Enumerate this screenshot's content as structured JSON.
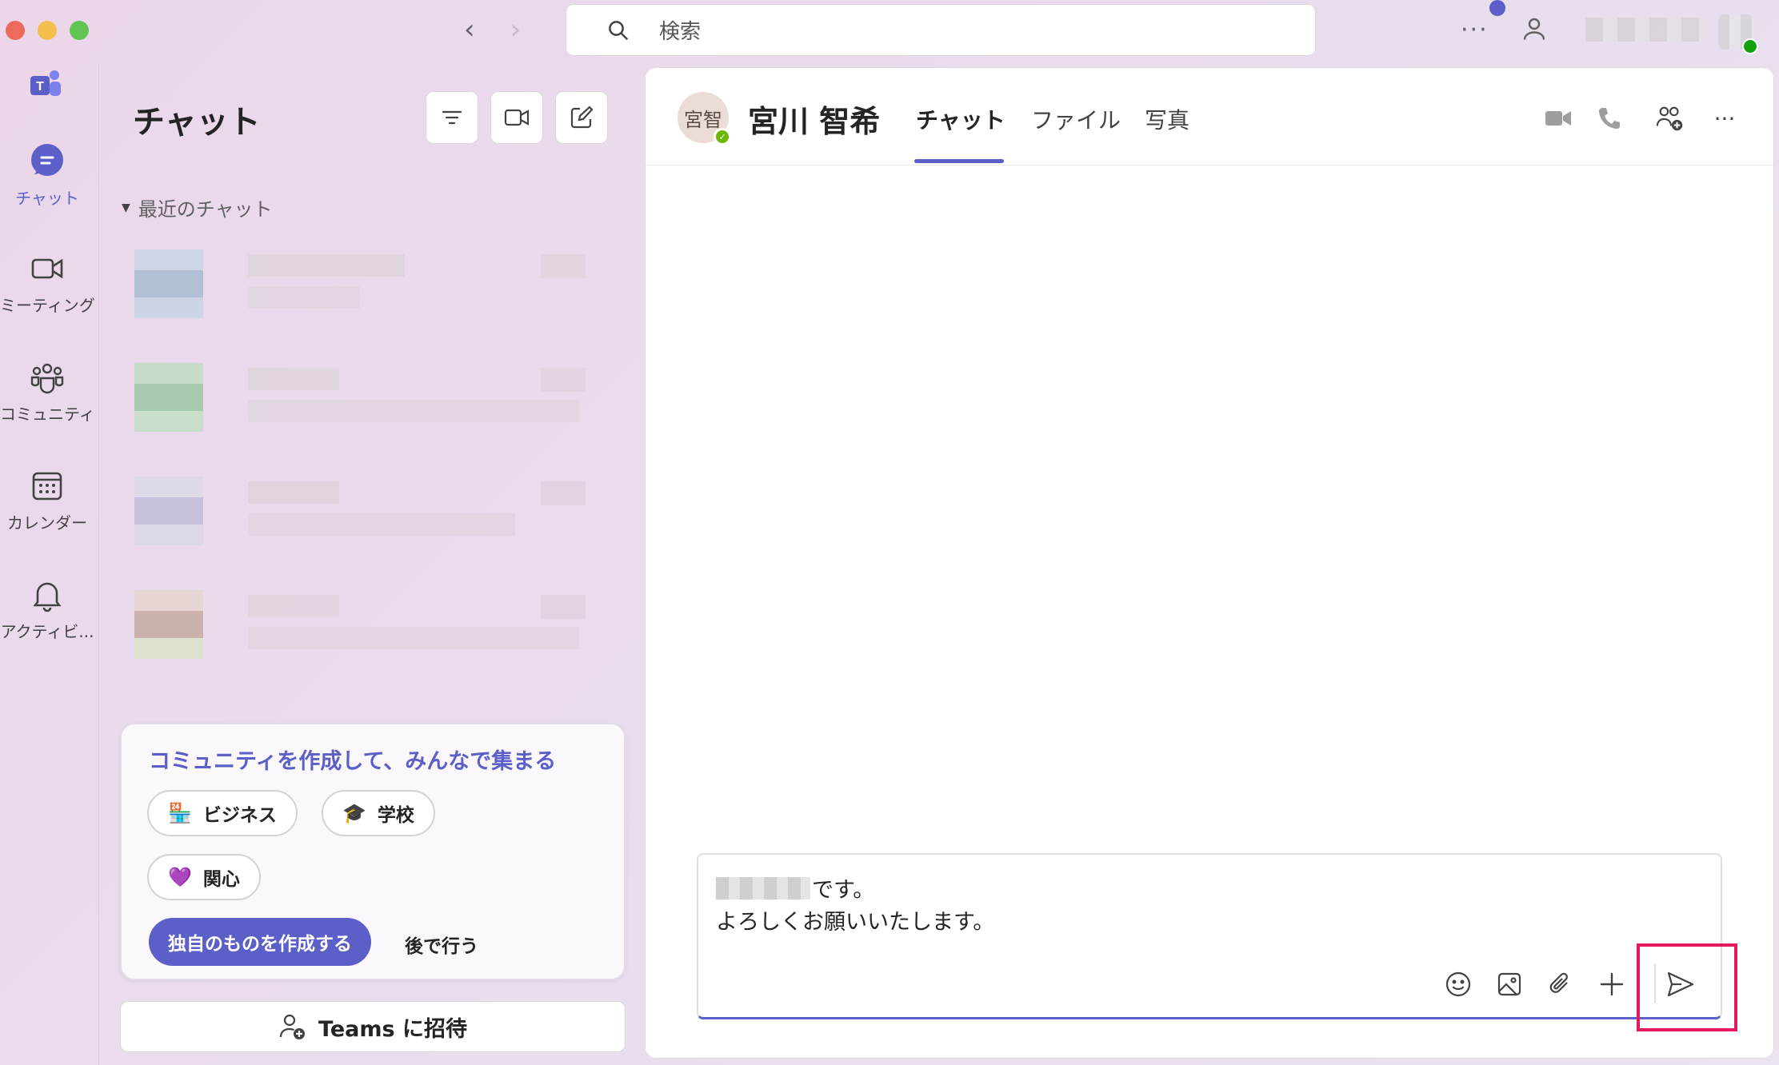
{
  "window": {
    "search_placeholder": "検索"
  },
  "rail": {
    "items": [
      {
        "label": "チャット",
        "active": true
      },
      {
        "label": "ミーティング"
      },
      {
        "label": "コミュニティ"
      },
      {
        "label": "カレンダー"
      },
      {
        "label": "アクティビ..."
      }
    ]
  },
  "chat_panel": {
    "title": "チャット",
    "section_label": "最近のチャット"
  },
  "community_card": {
    "title": "コミュニティを作成して、みんなで集まる",
    "chips": [
      {
        "emoji": "🏪",
        "label": "ビジネス"
      },
      {
        "emoji": "🎓",
        "label": "学校"
      },
      {
        "emoji": "💜",
        "label": "関心"
      }
    ],
    "primary_label": "独自のものを作成する",
    "later_label": "後で行う"
  },
  "invite": {
    "label": "Teams に招待"
  },
  "conversation": {
    "avatar_initials": "宮智",
    "person_name": "宮川 智希",
    "tabs": [
      "チャット",
      "ファイル",
      "写真"
    ],
    "active_tab": "チャット"
  },
  "composer": {
    "line1_suffix": "です。",
    "line2": "よろしくお願いいたします。"
  },
  "colors": {
    "accent": "#5b5fc7",
    "highlight": "#e6195e",
    "presence": "#6bb700"
  }
}
